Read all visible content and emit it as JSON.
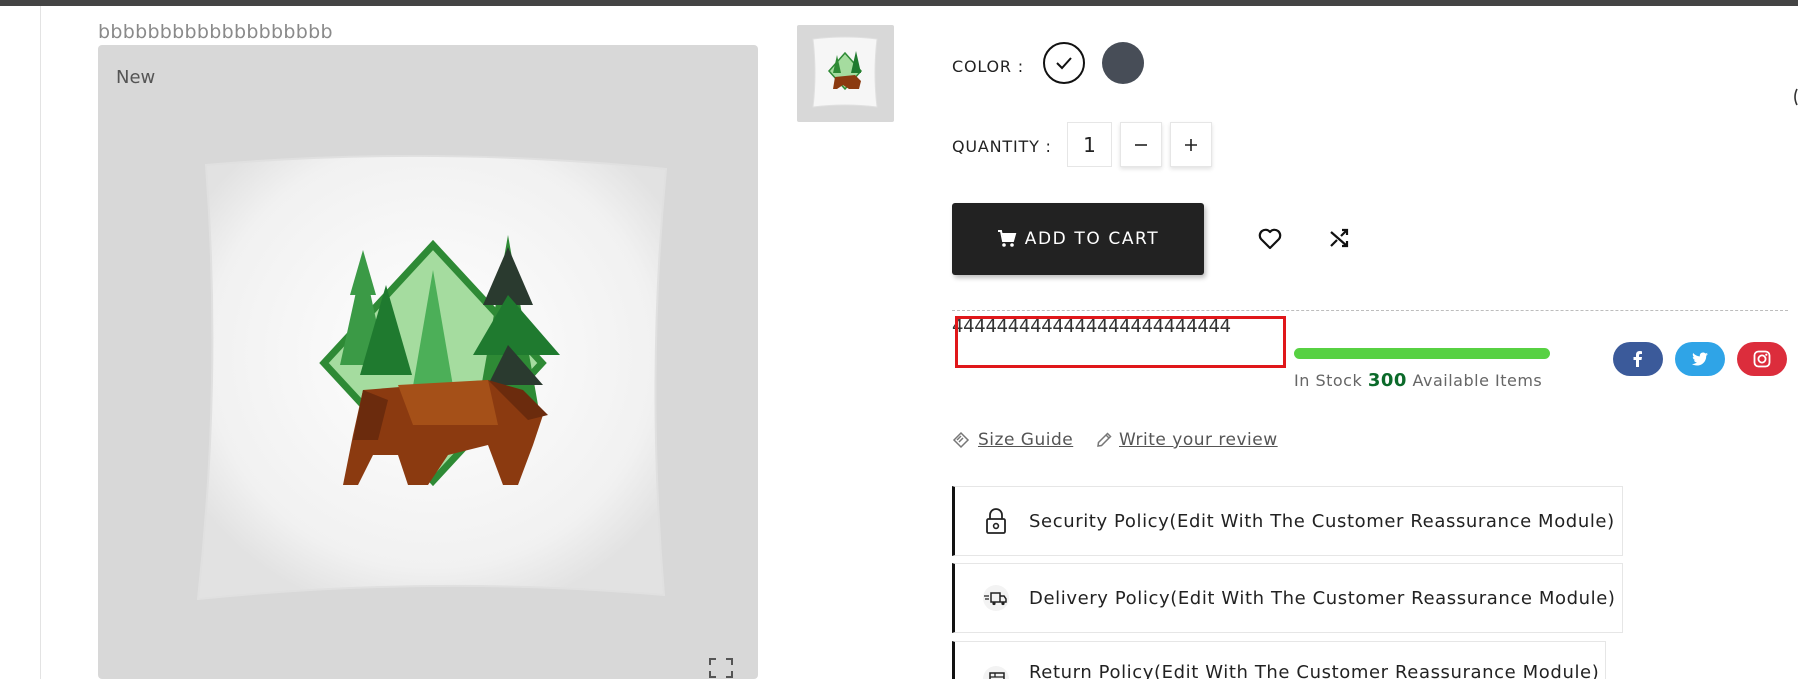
{
  "product": {
    "name": "bbbbbbbbbbbbbbbbbbb",
    "badge": "New"
  },
  "options": {
    "color_label": "COLOR :",
    "colors": [
      "#ffffff",
      "#474d57"
    ],
    "selected_color": "#ffffff",
    "quantity_label": "QUANTITY :",
    "quantity_value": "1"
  },
  "actions": {
    "add_to_cart_label": "ADD TO CART"
  },
  "details": {
    "reference": "4444444444444444444444444",
    "stock_prefix": "In Stock",
    "stock_count": "300",
    "stock_suffix": "Available Items",
    "stock_level_percent": 100
  },
  "links": {
    "size_guide": "Size Guide",
    "write_review": "Write your review"
  },
  "policies": [
    {
      "label": "Security Policy(Edit With The Customer Reassurance Module)",
      "icon": "lock-icon"
    },
    {
      "label": "Delivery Policy(Edit With The Customer Reassurance Module)",
      "icon": "delivery-truck-icon"
    },
    {
      "label": "Return Policy(Edit With The Customer Reassurance Module)",
      "icon": "return-package-icon"
    }
  ],
  "social": [
    {
      "name": "facebook",
      "icon": "facebook-icon",
      "color": "#3b5a9a"
    },
    {
      "name": "twitter",
      "icon": "twitter-icon",
      "color": "#2fa4e7"
    },
    {
      "name": "instagram",
      "icon": "instagram-icon",
      "color": "#dc2d3c"
    }
  ],
  "colors": {
    "button_dark": "#222222",
    "stock_bar": "#57d142",
    "stock_count": "#0b6a2a",
    "highlight": "#e0171a"
  }
}
